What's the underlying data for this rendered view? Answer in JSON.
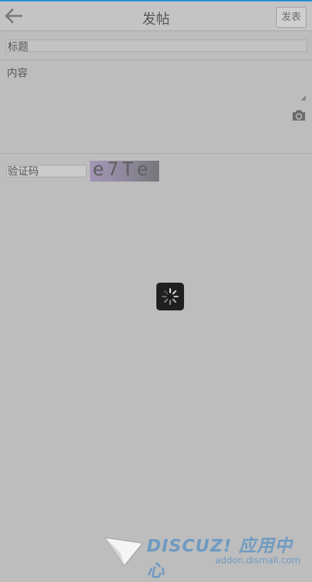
{
  "header": {
    "title": "发帖",
    "publish_label": "发表",
    "back_icon": "arrow-left-icon"
  },
  "form": {
    "title_placeholder": "标题",
    "content_placeholder": "内容",
    "captcha_placeholder": "验证码",
    "captcha_text": "e7Te",
    "camera_icon": "camera-icon"
  },
  "overlay": {
    "loading_icon": "loading-spinner-icon"
  },
  "watermark": {
    "brand": "DISCUZ! 应用中心",
    "url": "addon.dismall.com"
  },
  "colors": {
    "accent_line": "#1e8fd4",
    "page_bg": "#bdbdbd",
    "watermark": "#6f9ac2"
  }
}
